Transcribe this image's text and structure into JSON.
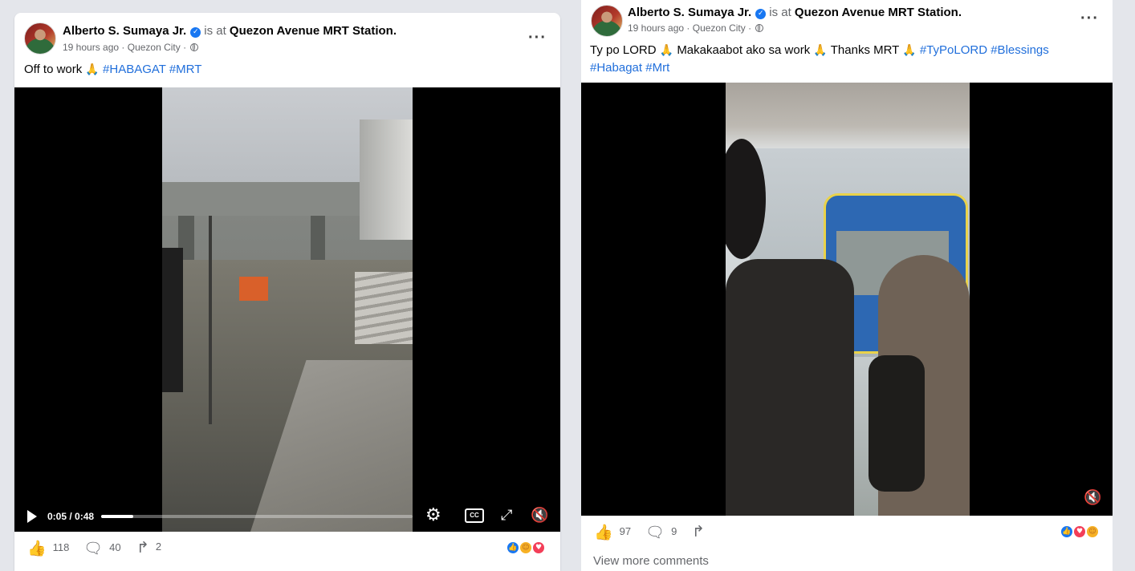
{
  "post_left": {
    "author": "Alberto S. Sumaya Jr.",
    "is_at": "is at",
    "place": "Quezon Avenue MRT Station.",
    "time": "19 hours ago",
    "city": "Quezon City",
    "text_plain": "Off to work",
    "hashtags": [
      "#HABAGAT",
      "#MRT"
    ],
    "video": {
      "time_display": "0:05 / 0:48",
      "progress": 0.104,
      "icons": [
        "play-icon",
        "settings-icon",
        "captions-icon",
        "fullscreen-icon",
        "mute-icon"
      ]
    },
    "likes": "118",
    "comments": "40",
    "shares": "2",
    "reactions": [
      "like",
      "care",
      "love"
    ]
  },
  "post_right": {
    "author": "Alberto S. Sumaya Jr.",
    "is_at": "is at",
    "place": "Quezon Avenue MRT Station.",
    "time": "19 hours ago",
    "city": "Quezon City",
    "text_part1": "Ty po LORD",
    "text_part2": "Makakaabot ako sa work",
    "text_part3": "Thanks MRT",
    "hashtags": [
      "#TyPoLORD",
      "#Blessings",
      "#Habagat",
      "#Mrt"
    ],
    "likes": "97",
    "comments": "9",
    "reactions": [
      "like",
      "love",
      "care"
    ],
    "view_more": "View more comments"
  },
  "colors": {
    "hashtag": "#216fdb",
    "muted": "#65676b",
    "accent": "#1877f2"
  }
}
